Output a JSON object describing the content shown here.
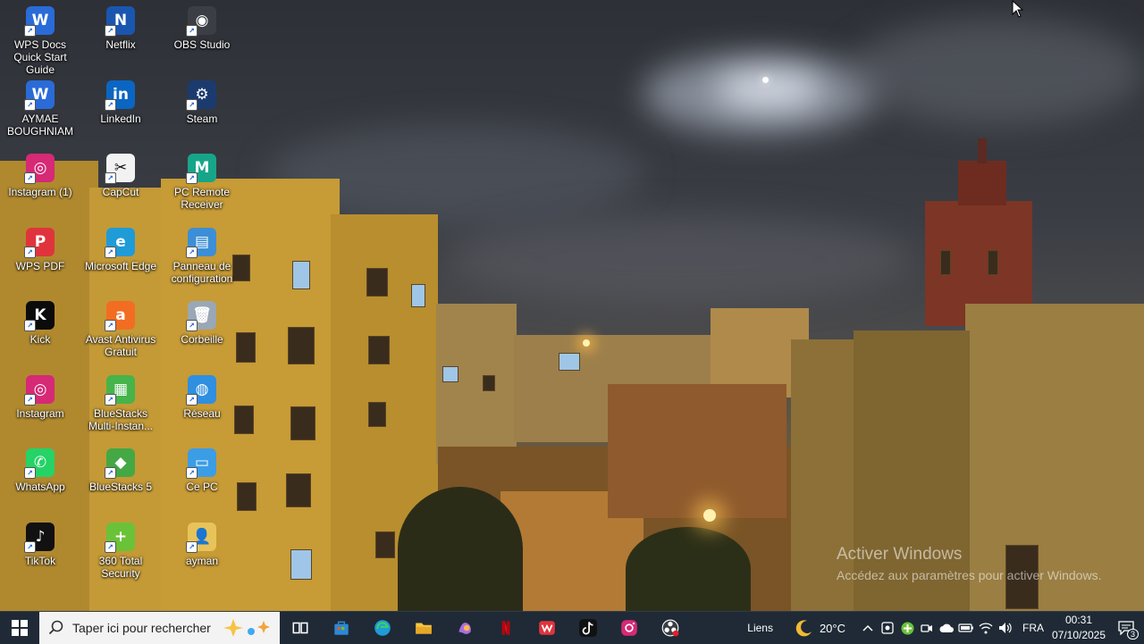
{
  "desktop": {
    "icons": [
      {
        "label": "WPS Docs Quick Start Guide",
        "glyph": "W",
        "color": "#2a6bd8",
        "icon": "wps-docs-icon"
      },
      {
        "label": "Netflix",
        "glyph": "N",
        "color": "#1a56b0",
        "icon": "netflix-icon"
      },
      {
        "label": "OBS Studio",
        "glyph": "◉",
        "color": "#3b3f45",
        "icon": "obs-icon"
      },
      {
        "label": "AYMAE BOUGHNIAM",
        "glyph": "W",
        "color": "#2a6bd8",
        "icon": "word-document-icon"
      },
      {
        "label": "LinkedIn",
        "glyph": "in",
        "color": "#0a66c2",
        "icon": "linkedin-icon"
      },
      {
        "label": "Steam",
        "glyph": "⚙",
        "color": "#1b3b6f",
        "icon": "steam-icon"
      },
      {
        "label": "Instagram (1)",
        "glyph": "◎",
        "color": "#d62976",
        "icon": "instagram-icon"
      },
      {
        "label": "CapCut",
        "glyph": "✂",
        "color": "#f2f2f2",
        "icon": "capcut-icon"
      },
      {
        "label": "PC Remote Receiver",
        "glyph": "M",
        "color": "#17a589",
        "icon": "pc-remote-icon"
      },
      {
        "label": "WPS PDF",
        "glyph": "P",
        "color": "#e0343d",
        "icon": "wps-pdf-icon"
      },
      {
        "label": "Microsoft Edge",
        "glyph": "e",
        "color": "#1f9bd7",
        "icon": "edge-icon"
      },
      {
        "label": "Panneau de configuration",
        "glyph": "▤",
        "color": "#3c8fd6",
        "icon": "control-panel-icon"
      },
      {
        "label": "Kick",
        "glyph": "K",
        "color": "#0b0b0b",
        "icon": "kick-icon"
      },
      {
        "label": "Avast Antivirus Gratuit",
        "glyph": "a",
        "color": "#f26d21",
        "icon": "avast-icon"
      },
      {
        "label": "Corbeille",
        "glyph": "🗑",
        "color": "#9aa7b4",
        "icon": "recycle-bin-icon"
      },
      {
        "label": "Instagram",
        "glyph": "◎",
        "color": "#d62976",
        "icon": "instagram-icon"
      },
      {
        "label": "BlueStacks Multi-Instan...",
        "glyph": "▦",
        "color": "#46b34b",
        "icon": "bluestacks-multi-icon"
      },
      {
        "label": "Réseau",
        "glyph": "◍",
        "color": "#2f8fe0",
        "icon": "network-icon"
      },
      {
        "label": "WhatsApp",
        "glyph": "✆",
        "color": "#25d366",
        "icon": "whatsapp-icon"
      },
      {
        "label": "BlueStacks 5",
        "glyph": "◆",
        "color": "#44a845",
        "icon": "bluestacks-icon"
      },
      {
        "label": "Ce PC",
        "glyph": "▭",
        "color": "#3b9de6",
        "icon": "this-pc-icon"
      },
      {
        "label": "TikTok",
        "glyph": "♪",
        "color": "#111111",
        "icon": "tiktok-icon"
      },
      {
        "label": "360 Total Security",
        "glyph": "+",
        "color": "#6ac238",
        "icon": "360-security-icon"
      },
      {
        "label": "ayman",
        "glyph": "👤",
        "color": "#e8c35a",
        "icon": "user-folder-icon"
      }
    ]
  },
  "watermark": {
    "title": "Activer Windows",
    "subtitle": "Accédez aux paramètres pour activer Windows."
  },
  "taskbar": {
    "search_placeholder": "Taper ici pour rechercher",
    "apps": [
      {
        "name": "task-view",
        "color": "#ffffff"
      },
      {
        "name": "microsoft-store",
        "color": "#2b88d8"
      },
      {
        "name": "edge",
        "color": "#1f9bd7"
      },
      {
        "name": "file-explorer",
        "color": "#f5c342"
      },
      {
        "name": "copilot",
        "color": "#a86ee0"
      },
      {
        "name": "netflix",
        "color": "#e50914"
      },
      {
        "name": "wps-office",
        "color": "#e0343d"
      },
      {
        "name": "tiktok",
        "color": "#111111"
      },
      {
        "name": "instagram",
        "color": "#d62976"
      },
      {
        "name": "obs",
        "color": "#3b3f45"
      }
    ],
    "links_label": "Liens",
    "weather": {
      "temperature": "20°C"
    },
    "language": "FRA",
    "clock": {
      "time": "00:31",
      "date": "07/10/2025"
    },
    "notification_count": "3"
  }
}
